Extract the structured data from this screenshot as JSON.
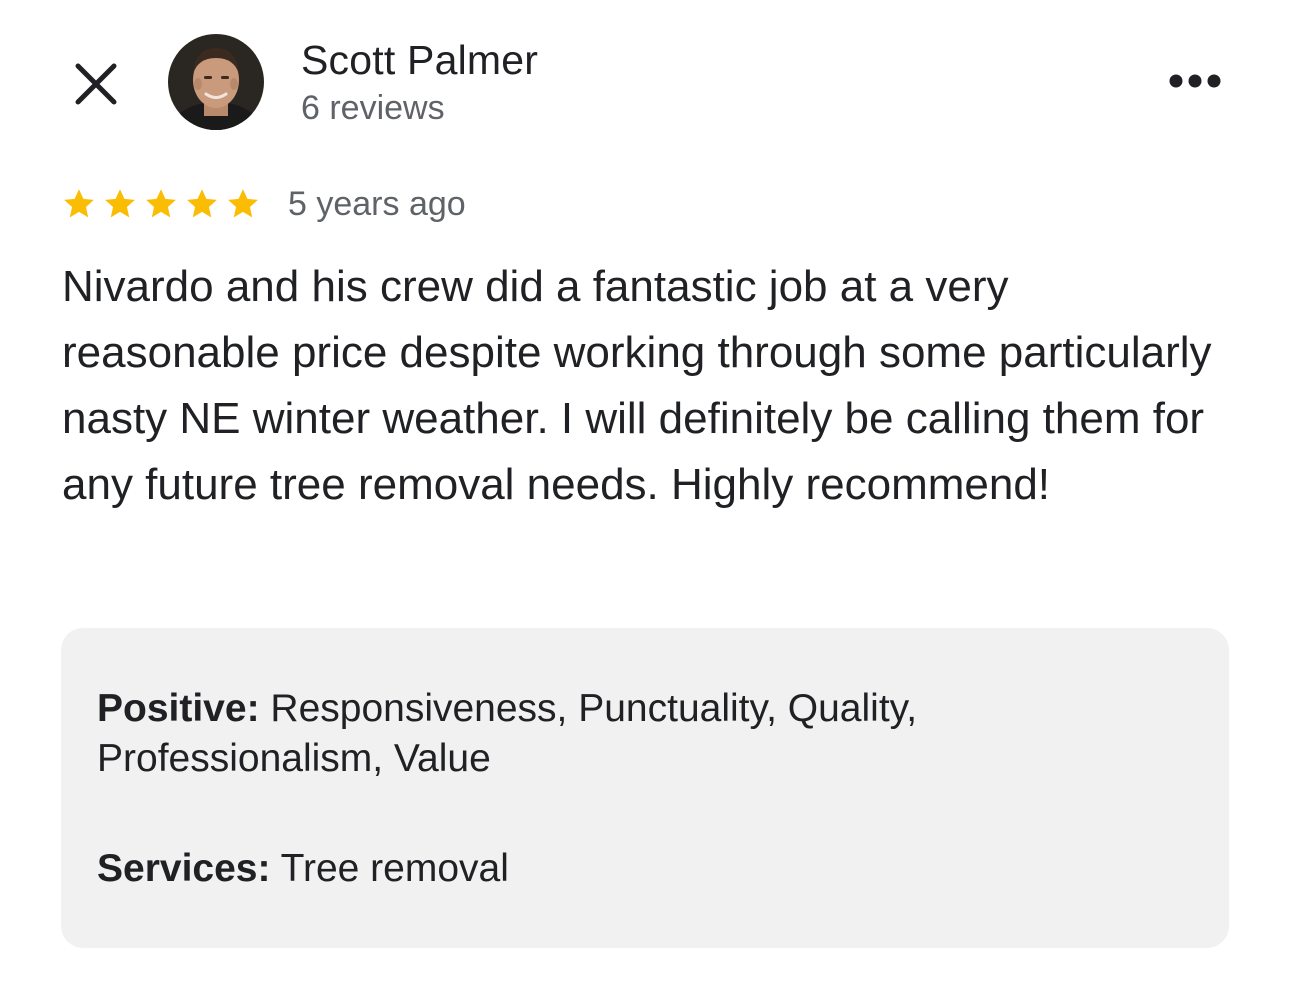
{
  "header": {
    "close_icon": "close-icon",
    "more_icon": "more-horizontal-icon",
    "avatar_icon": "reviewer-photo"
  },
  "reviewer": {
    "name": "Scott Palmer",
    "review_count": "6 reviews"
  },
  "review": {
    "rating": 5,
    "rating_max": 5,
    "star_color": "#fbbc04",
    "age": "5 years ago",
    "text": "Nivardo and his crew did a fantastic job at a very reasonable price despite working through some particularly nasty NE winter weather.  I will definitely be calling them for any future tree removal needs. Highly recommend!"
  },
  "attributes": {
    "positive_label": "Positive:",
    "positive_value": " Responsiveness, Punctuality, Quality, Professionalism, Value",
    "services_label": "Services:",
    "services_value": " Tree removal"
  }
}
